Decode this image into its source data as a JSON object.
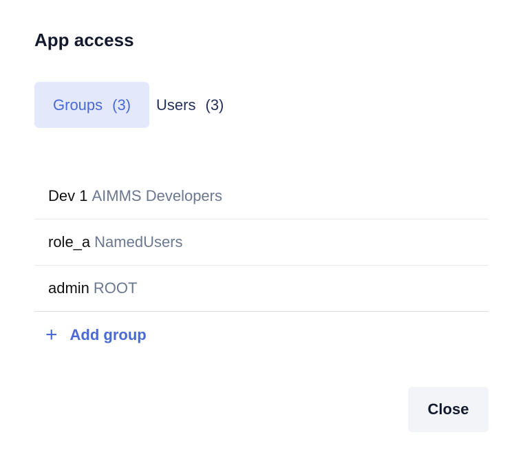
{
  "dialog": {
    "title": "App access",
    "tabs": [
      {
        "label": "Groups",
        "count": "(3)",
        "active": true
      },
      {
        "label": "Users",
        "count": "(3)",
        "active": false
      }
    ],
    "groups": [
      {
        "name": "Dev 1",
        "group": "AIMMS Developers"
      },
      {
        "name": "role_a",
        "group": "NamedUsers"
      },
      {
        "name": "admin",
        "group": "ROOT"
      }
    ],
    "add_group_icon": "plus-icon",
    "add_group_label": "Add group",
    "close_label": "Close"
  },
  "colors": {
    "accent": "#4a6ad6",
    "active_tab_bg": "#e3e8fa",
    "secondary_text": "#6c7790",
    "button_bg": "#f3f4f7"
  }
}
